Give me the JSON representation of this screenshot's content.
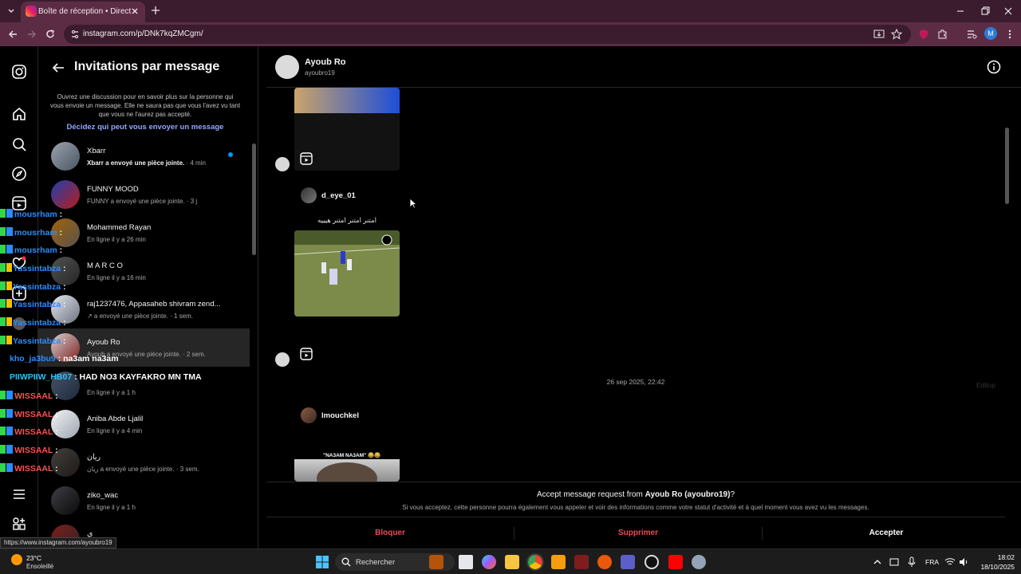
{
  "browser": {
    "tab_title": "Boîte de réception • Direct",
    "url": "instagram.com/p/DNk7kqZMCgm/",
    "profile_initial": "M",
    "status_url": "https://www.instagram.com/ayoubro19"
  },
  "requests": {
    "title": "Invitations par message",
    "info": "Ouvrez une discussion pour en savoir plus sur la personne qui vous envoie un message. Elle ne saura pas que vous l'avez vu tant que vous ne l'aurez pas accepté.",
    "who_can_message": "Décidez qui peut vous envoyer un message",
    "items": [
      {
        "name": "Xbarr",
        "sub_bold": "Xbarr a envoyé une pièce jointe.",
        "sub": " · 4 min",
        "unread": true
      },
      {
        "name": "FUNNY MOOD",
        "sub_bold": "",
        "sub": "FUNNY a envoyé une pièce jointe. · 3 j"
      },
      {
        "name": "Mohammed Rayan",
        "sub_bold": "",
        "sub": "En ligne il y a 26 min"
      },
      {
        "name": "M A R C O",
        "sub_bold": "",
        "sub": "En ligne il y a 16 min"
      },
      {
        "name": "raj1237476, Appasaheb shivram zend...",
        "sub_bold": "",
        "sub": "↗ a envoyé une pièce jointe. · 1 sem."
      },
      {
        "name": "Ayoub Ro",
        "sub_bold": "",
        "sub": "Ayoub a envoyé une pièce jointe. · 2 sem."
      },
      {
        "name": "",
        "sub_bold": "",
        "sub": "En ligne il y a 1 h"
      },
      {
        "name": "Aniba Abde Ljalil",
        "sub_bold": "",
        "sub": "En ligne il y a 4 min"
      },
      {
        "name": "ريان",
        "sub_bold": "",
        "sub": "ريان a envoyé une pièce jointe. · 3 sem."
      },
      {
        "name": "ziko_wac",
        "sub_bold": "",
        "sub": "En ligne il y a 1 h"
      },
      {
        "name": "ي",
        "sub_bold": "",
        "sub": ""
      }
    ]
  },
  "overlay_chat": [
    {
      "user": "mousrham",
      "msg": " :",
      "color": "blue"
    },
    {
      "user": "mousrham",
      "msg": " :",
      "color": "blue"
    },
    {
      "user": "mousrham",
      "msg": " :",
      "color": "blue"
    },
    {
      "user": "Yassintabza",
      "msg": " :",
      "color": "blue"
    },
    {
      "user": "Yassintabza",
      "msg": " :",
      "color": "blue"
    },
    {
      "user": "Yassintabza",
      "msg": " :",
      "color": "blue"
    },
    {
      "user": "Yassintabza",
      "msg": " :",
      "color": "blue"
    },
    {
      "user": "Yassintabza",
      "msg": " :",
      "color": "blue"
    },
    {
      "user": "kho_ja3bu9",
      "msg": " : na3am na3am",
      "color": "blue"
    },
    {
      "user": "PIIWPIIW_HB07",
      "msg": " : HAD NO3 KAYFAKRO MN TMA",
      "color": "cyan"
    },
    {
      "user": "WISSAAL",
      "msg": " :",
      "color": "red"
    },
    {
      "user": "WISSAAL",
      "msg": " :",
      "color": "red"
    },
    {
      "user": "WISSAAL",
      "msg": " :",
      "color": "red"
    },
    {
      "user": "WISSAAL",
      "msg": " :",
      "color": "red"
    },
    {
      "user": "WISSAAL",
      "msg": " :",
      "color": "red"
    },
    {
      "user": "WISSAAL",
      "msg": " :",
      "color": "red"
    }
  ],
  "conversation": {
    "name": "Ayoub Ro",
    "handle": "ayoubro19",
    "post1_user": "d_eye_01",
    "post1_caption": "امتنر امتنر امتنر هيييه",
    "timestamp": "26 sep 2025, 22:42",
    "edit_label": "Editup",
    "post2_user": "lmouchkel",
    "post2_caption": "\"NA3AM NA3AM\" 😂😂"
  },
  "accept_bar": {
    "question_prefix": "Accept message request from ",
    "question_name": "Ayoub Ro (ayoubro19)",
    "question_suffix": "?",
    "note": "Si vous acceptez, cette personne pourra également vous appeler et voir des informations comme votre statut d'activité et à quel moment vous avez vu les messages.",
    "block": "Bloquer",
    "delete": "Supprimer",
    "accept": "Accepter"
  },
  "taskbar": {
    "temperature": "23°C",
    "condition": "Ensoleillé",
    "search": "Rechercher",
    "language": "FRA",
    "time": "18:02",
    "date": "18/10/2025"
  },
  "colors": {
    "danger": "#ed4956",
    "link": "#93a8ff",
    "unread": "#0095f6"
  }
}
